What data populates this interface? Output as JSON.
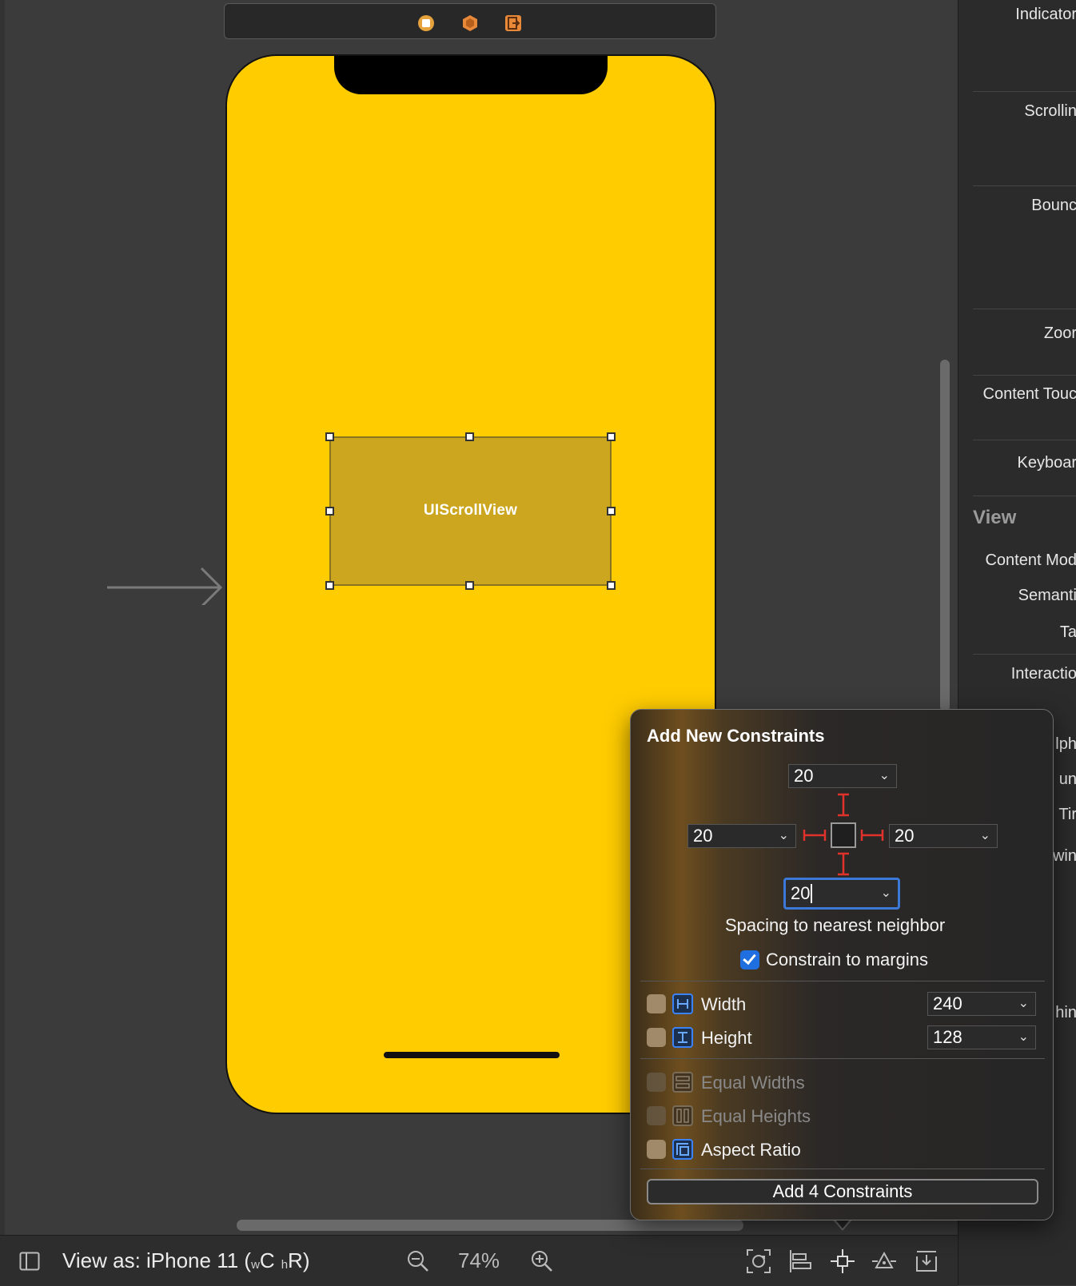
{
  "canvas": {
    "scene_dock": {
      "icons": [
        "view-controller-icon",
        "first-responder-icon",
        "exit-icon"
      ]
    },
    "scroll_view_label": "UIScrollView",
    "phone_color": "#ffcc00"
  },
  "inspector": {
    "labels": [
      "Indicator",
      "Scrollin",
      "Bounc",
      "Zoor",
      "Content Touc",
      "Keyboar",
      "Content Mod",
      "Semanti",
      "Ta",
      "Interactio",
      "lph",
      "un",
      "Tir",
      "win",
      "hin"
    ],
    "section_view": "View"
  },
  "popover": {
    "title": "Add New Constraints",
    "top_value": "20",
    "left_value": "20",
    "right_value": "20",
    "bottom_value": "20",
    "spacing_label": "Spacing to nearest neighbor",
    "constrain_margins_label": "Constrain to margins",
    "width_label": "Width",
    "width_value": "240",
    "height_label": "Height",
    "height_value": "128",
    "equal_widths_label": "Equal Widths",
    "equal_heights_label": "Equal Heights",
    "aspect_ratio_label": "Aspect Ratio",
    "add_button_label": "Add 4 Constraints"
  },
  "bottom_bar": {
    "view_as_prefix": "View as: iPhone 11 (",
    "w_small": "w",
    "w_class": "C",
    "h_small": "h",
    "h_class": "R)",
    "zoom": "74%"
  }
}
